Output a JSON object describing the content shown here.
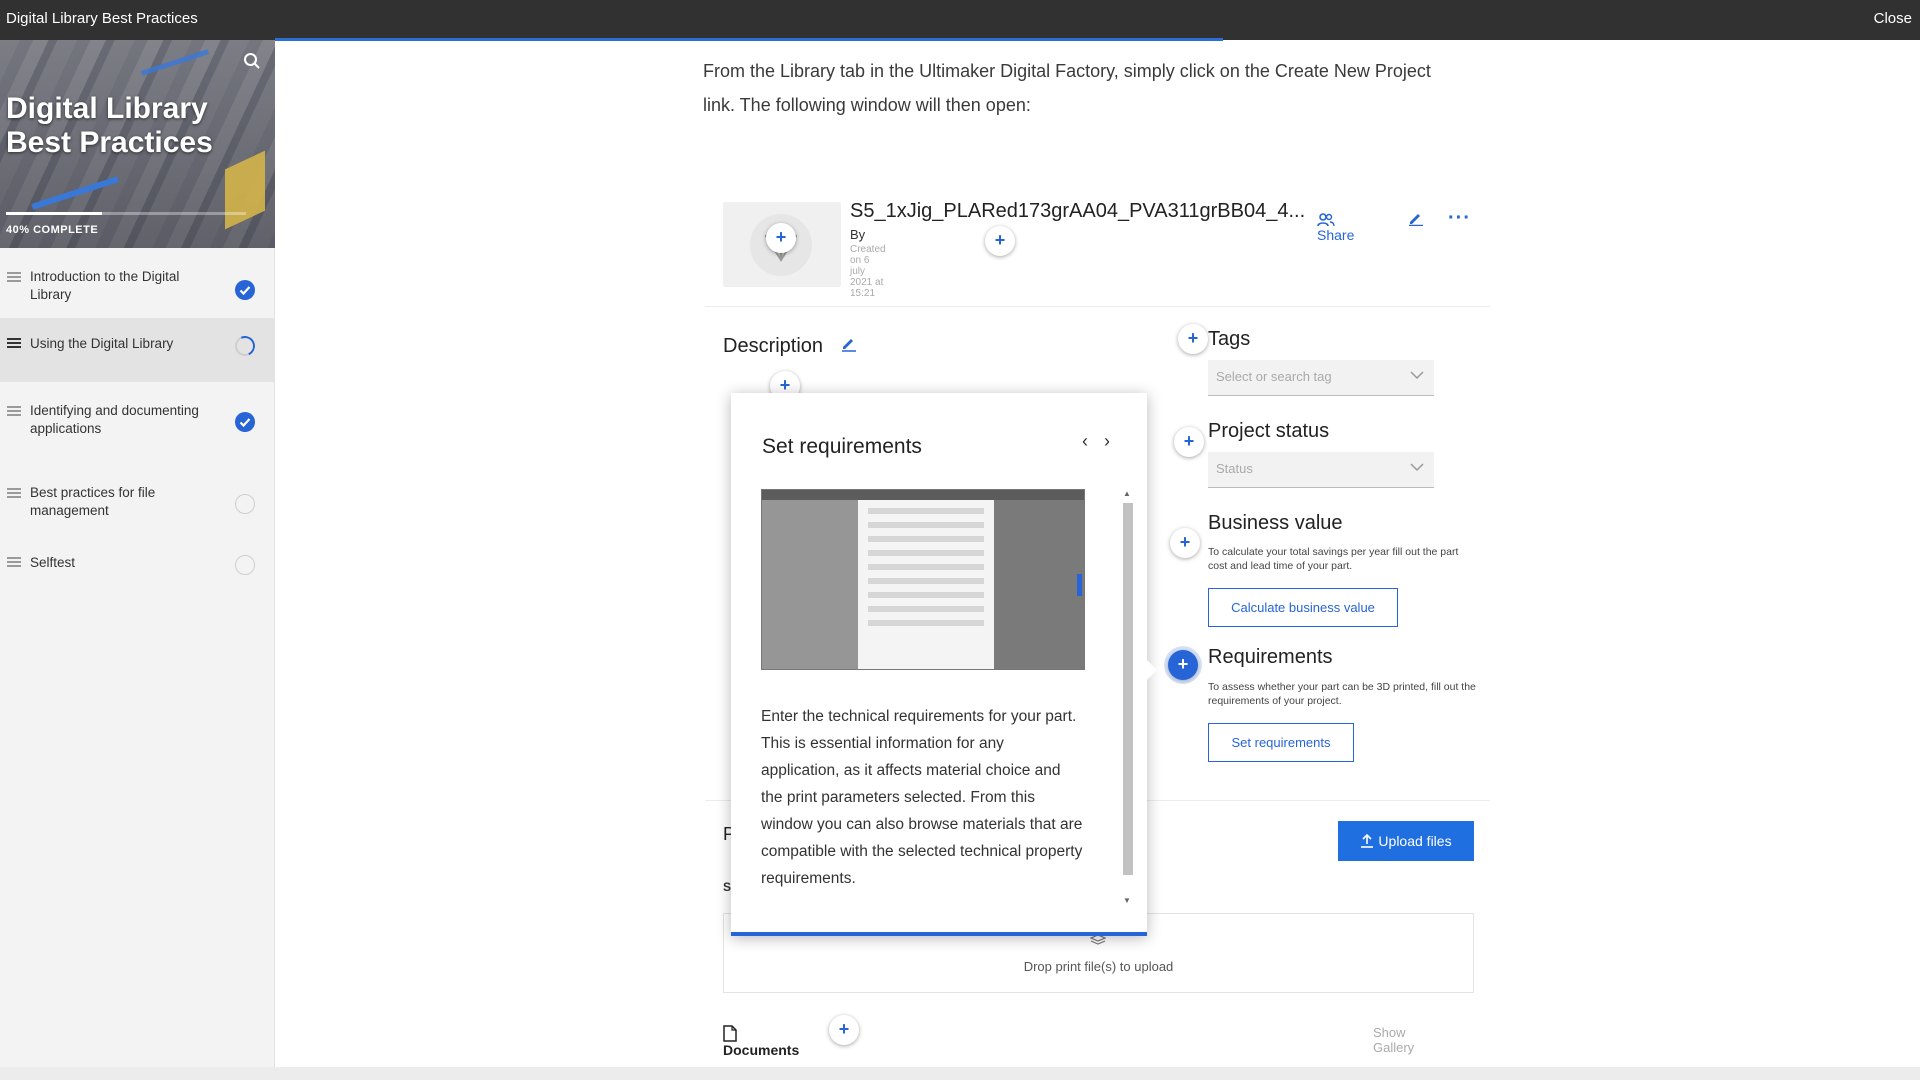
{
  "topbar": {
    "title": "Digital Library Best Practices",
    "close_label": "Close"
  },
  "sidebar": {
    "course_title": "Digital Library Best Practices",
    "progress_label": "40% COMPLETE",
    "progress_fraction": 0.4,
    "lessons": [
      {
        "label": "Introduction to the Digital Library",
        "status": "complete"
      },
      {
        "label": "Using the Digital Library",
        "status": "in-progress"
      },
      {
        "label": "Identifying and documenting applications",
        "status": "complete"
      },
      {
        "label": "Best practices for file management",
        "status": "not-started"
      },
      {
        "label": "Selftest",
        "status": "not-started"
      }
    ]
  },
  "main": {
    "intro_text": "From the Library tab in the Ultimaker Digital Factory, simply click on the Create New Project link. The following window will then open:"
  },
  "screenshot": {
    "project_title": "S5_1xJig_PLARed173grAA04_PVA311grBB04_4...",
    "by_label": "By",
    "created_label": "Created on 6 july 2021 at 15:21",
    "share_label": "Share",
    "description_heading": "Description",
    "tags_heading": "Tags",
    "tags_placeholder": "Select or search tag",
    "status_heading": "Project status",
    "status_placeholder": "Status",
    "business_heading": "Business value",
    "business_text": "To calculate your total savings per year fill out the part cost and lead time of your part.",
    "business_button": "Calculate business value",
    "requirements_heading": "Requirements",
    "requirements_text": "To assess whether your part can be 3D printed, fill out the requirements of your project.",
    "requirements_button": "Set requirements",
    "files_heading": "P",
    "files_sub": "S",
    "upload_button": "Upload files",
    "drop_text": "Drop print file(s) to upload",
    "documents_label": "Documents",
    "gallery_label": "Show Gallery",
    "accent_color": "#2764d6"
  },
  "popup": {
    "title": "Set requirements",
    "prev_icon": "chevron-left-icon",
    "next_icon": "chevron-right-icon",
    "body": "Enter the technical requirements for your part. This is essential information for any application, as it affects material choice and the print parameters selected. From this window you can also browse materials that are compatible with the selected technical property requirements."
  }
}
